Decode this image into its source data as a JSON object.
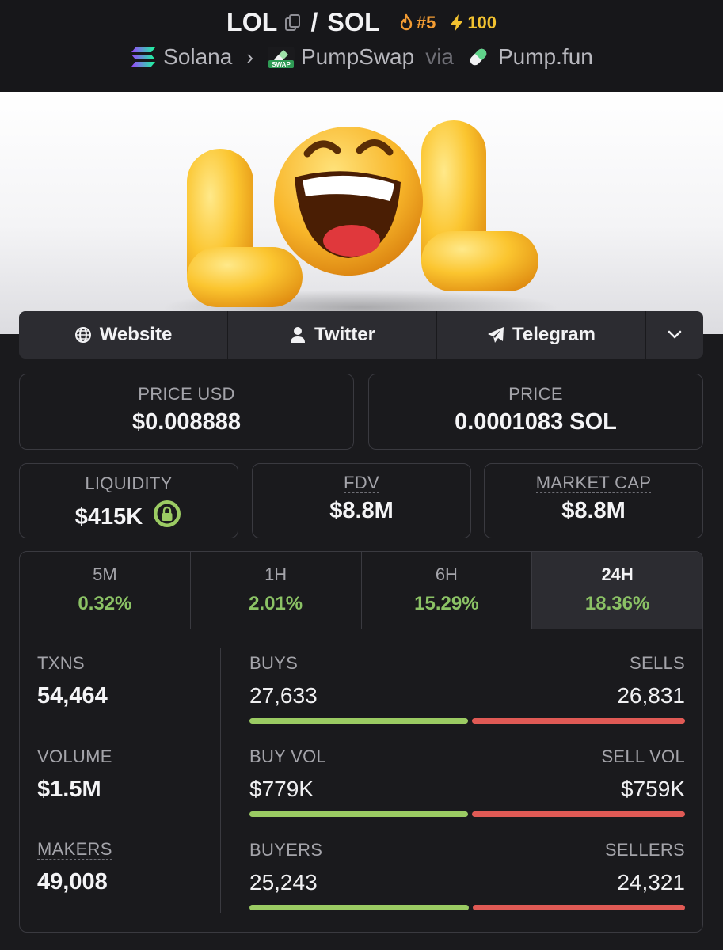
{
  "header": {
    "base": "LOL",
    "quote": "SOL",
    "separator": "/",
    "rank": "#5",
    "boosts": "100",
    "chain": "Solana",
    "dex": "PumpSwap",
    "dex_badge": "SWAP",
    "via": "via",
    "launchpad": "Pump.fun"
  },
  "banner": {
    "text": "LOL"
  },
  "social": {
    "website": "Website",
    "twitter": "Twitter",
    "telegram": "Telegram"
  },
  "stats": {
    "price_usd_label": "PRICE USD",
    "price_usd": "$0.008888",
    "price_label": "PRICE",
    "price": "0.0001083 SOL",
    "liquidity_label": "LIQUIDITY",
    "liquidity": "$415K",
    "fdv_label": "FDV",
    "fdv": "$8.8M",
    "mcap_label": "MARKET CAP",
    "mcap": "$8.8M"
  },
  "changes": [
    {
      "label": "5M",
      "value": "0.32%"
    },
    {
      "label": "1H",
      "value": "2.01%"
    },
    {
      "label": "6H",
      "value": "15.29%"
    },
    {
      "label": "24H",
      "value": "18.36%",
      "active": true
    }
  ],
  "metrics": {
    "txns_label": "TXNS",
    "txns": "54,464",
    "volume_label": "VOLUME",
    "volume": "$1.5M",
    "makers_label": "MAKERS",
    "makers": "49,008"
  },
  "splits": [
    {
      "left_label": "BUYS",
      "right_label": "SELLS",
      "left": "27,633",
      "right": "26,831",
      "buy_share": 0.507
    },
    {
      "left_label": "BUY VOL",
      "right_label": "SELL VOL",
      "left": "$779K",
      "right": "$759K",
      "buy_share": 0.507
    },
    {
      "left_label": "BUYERS",
      "right_label": "SELLERS",
      "left": "25,243",
      "right": "24,321",
      "buy_share": 0.509
    }
  ],
  "colors": {
    "positive": "#8bc265",
    "buy_bar": "#9bcb63",
    "sell_bar": "#e05a55",
    "rank": "#f39c33",
    "boost": "#f2c230"
  }
}
